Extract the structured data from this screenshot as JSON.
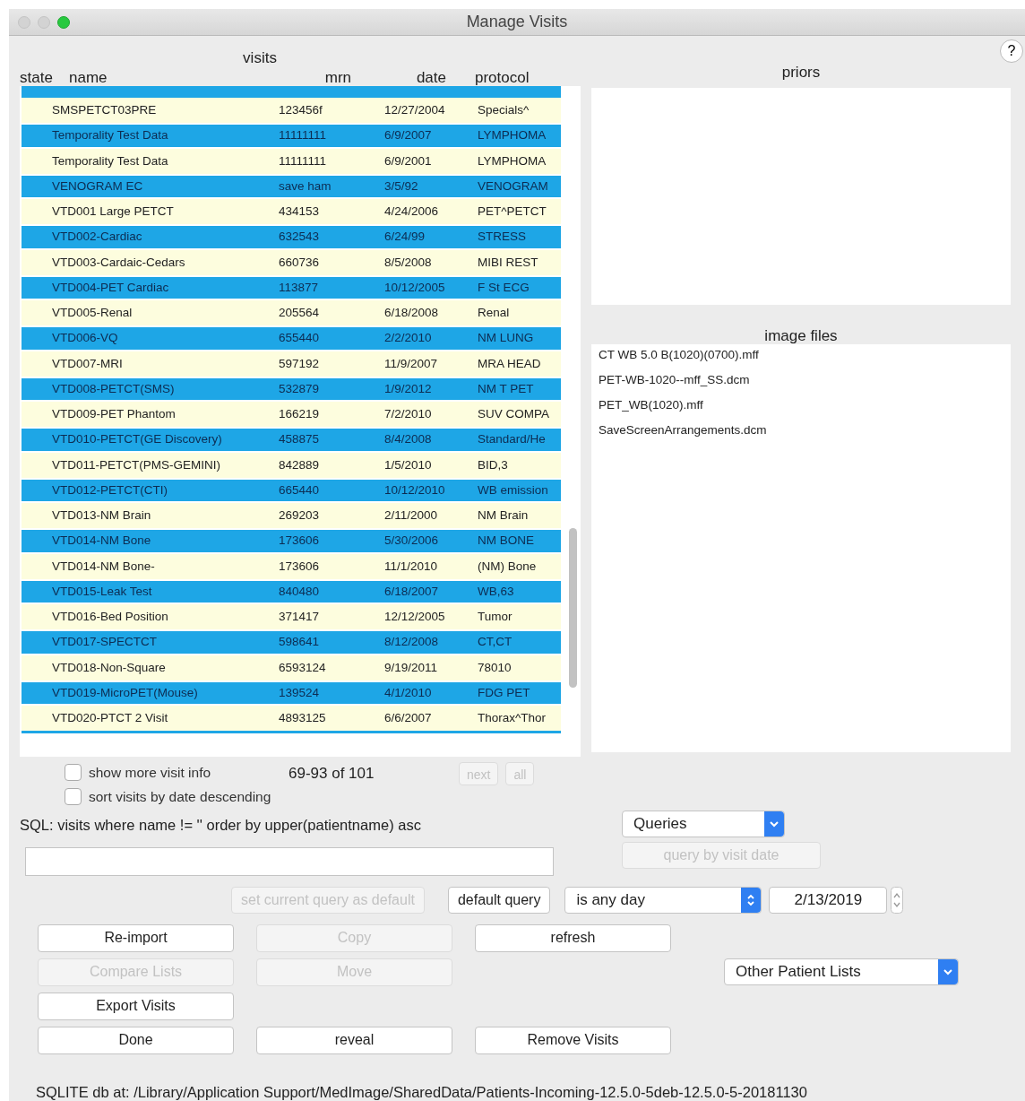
{
  "window": {
    "title": "Manage Visits"
  },
  "help_button": "?",
  "visits": {
    "title": "visits",
    "columns": [
      "state",
      "name",
      "mrn",
      "date",
      "protocol"
    ],
    "rows": [
      {
        "name": "SMSPETCT03PRE",
        "mrn": "123456f",
        "date": "12/27/2004",
        "protocol": "Specials^",
        "selected": false
      },
      {
        "name": "Temporality Test Data",
        "mrn": "11111111",
        "date": "6/9/2007",
        "protocol": "LYMPHOMA",
        "selected": true
      },
      {
        "name": "Temporality Test Data",
        "mrn": "11111111",
        "date": "6/9/2001",
        "protocol": "LYMPHOMA",
        "selected": false
      },
      {
        "name": "VENOGRAM EC",
        "mrn": "save ham",
        "date": "3/5/92",
        "protocol": "VENOGRAM",
        "selected": true
      },
      {
        "name": "VTD001 Large PETCT",
        "mrn": "434153",
        "date": "4/24/2006",
        "protocol": "PET^PETCT",
        "selected": false
      },
      {
        "name": "VTD002-Cardiac",
        "mrn": "632543",
        "date": "6/24/99",
        "protocol": "STRESS",
        "selected": true
      },
      {
        "name": "VTD003-Cardaic-Cedars",
        "mrn": "660736",
        "date": "8/5/2008",
        "protocol": "MIBI REST",
        "selected": false
      },
      {
        "name": "VTD004-PET Cardiac",
        "mrn": "113877",
        "date": "10/12/2005",
        "protocol": "F St ECG",
        "selected": true
      },
      {
        "name": "VTD005-Renal",
        "mrn": "205564",
        "date": "6/18/2008",
        "protocol": "Renal",
        "selected": false
      },
      {
        "name": "VTD006-VQ",
        "mrn": "655440",
        "date": "2/2/2010",
        "protocol": "NM LUNG",
        "selected": true
      },
      {
        "name": "VTD007-MRI",
        "mrn": "597192",
        "date": "11/9/2007",
        "protocol": "MRA HEAD",
        "selected": false
      },
      {
        "name": "VTD008-PETCT(SMS)",
        "mrn": "532879",
        "date": "1/9/2012",
        "protocol": "NM T PET",
        "selected": true
      },
      {
        "name": "VTD009-PET Phantom",
        "mrn": "166219",
        "date": "7/2/2010",
        "protocol": "SUV COMPA",
        "selected": false
      },
      {
        "name": "VTD010-PETCT(GE Discovery)",
        "mrn": "458875",
        "date": "8/4/2008",
        "protocol": "Standard/He",
        "selected": true
      },
      {
        "name": "VTD011-PETCT(PMS-GEMINI)",
        "mrn": "842889",
        "date": "1/5/2010",
        "protocol": "BID,3",
        "selected": false
      },
      {
        "name": "VTD012-PETCT(CTI)",
        "mrn": "665440",
        "date": "10/12/2010",
        "protocol": "WB emission",
        "selected": true
      },
      {
        "name": "VTD013-NM Brain",
        "mrn": "269203",
        "date": "2/11/2000",
        "protocol": "NM Brain",
        "selected": false
      },
      {
        "name": "VTD014-NM Bone",
        "mrn": "173606",
        "date": "5/30/2006",
        "protocol": "NM BONE",
        "selected": true
      },
      {
        "name": "VTD014-NM Bone-",
        "mrn": "173606",
        "date": "11/1/2010",
        "protocol": "(NM) Bone",
        "selected": false
      },
      {
        "name": "VTD015-Leak Test",
        "mrn": "840480",
        "date": "6/18/2007",
        "protocol": "WB,63",
        "selected": true
      },
      {
        "name": "VTD016-Bed Position",
        "mrn": "371417",
        "date": "12/12/2005",
        "protocol": "Tumor",
        "selected": false
      },
      {
        "name": "VTD017-SPECTCT",
        "mrn": "598641",
        "date": "8/12/2008",
        "protocol": "CT,CT",
        "selected": true
      },
      {
        "name": "VTD018-Non-Square",
        "mrn": "6593124",
        "date": "9/19/2011",
        "protocol": "78010",
        "selected": false
      },
      {
        "name": "VTD019-MicroPET(Mouse)",
        "mrn": "139524",
        "date": "4/1/2010",
        "protocol": "FDG PET",
        "selected": true
      },
      {
        "name": "VTD020-PTCT 2 Visit",
        "mrn": "4893125",
        "date": "6/6/2007",
        "protocol": "Thorax^Thor",
        "selected": false
      }
    ]
  },
  "priors": {
    "title": "priors"
  },
  "image_files": {
    "title": "image files",
    "items": [
      "CT WB 5.0 B(1020)(0700).mff",
      "PET-WB-1020--mff_SS.dcm",
      "PET_WB(1020).mff",
      "SaveScreenArrangements.dcm"
    ]
  },
  "options": [
    {
      "label": "show more visit info",
      "checked": false
    },
    {
      "label": "sort visits by date descending",
      "checked": false
    }
  ],
  "range": "69-93 of 101",
  "paging_buttons": [
    {
      "label": "next",
      "disabled": true
    },
    {
      "label": "all",
      "disabled": true
    }
  ],
  "sql": "SQL: visits where name != '' order by upper(patientname) asc",
  "queries_menu": "Queries",
  "query_by_visit_date": {
    "label": "query by visit date",
    "disabled": true
  },
  "query_buttons": [
    {
      "label": "set current query as default",
      "disabled": true
    },
    {
      "label": "default query",
      "disabled": false
    }
  ],
  "date_mode": "is any day",
  "date": "2/13/2019",
  "action_rows": [
    [
      {
        "label": "Re-import",
        "disabled": false
      },
      {
        "label": "Copy",
        "disabled": true
      },
      {
        "label": "refresh",
        "disabled": false
      }
    ],
    [
      {
        "label": "Compare Lists",
        "disabled": true
      },
      {
        "label": "Move",
        "disabled": true
      }
    ],
    [
      {
        "label": "Export Visits",
        "disabled": false
      }
    ],
    [
      {
        "label": "Done",
        "disabled": false
      },
      {
        "label": "reveal",
        "disabled": false
      },
      {
        "label": "Remove Visits",
        "disabled": false
      }
    ]
  ],
  "other_lists_menu": "Other Patient Lists",
  "status": "SQLITE db at: /Library/Application Support/MedImage/SharedData/Patients-Incoming-12.5.0-5deb-12.5.0-5-20181130"
}
